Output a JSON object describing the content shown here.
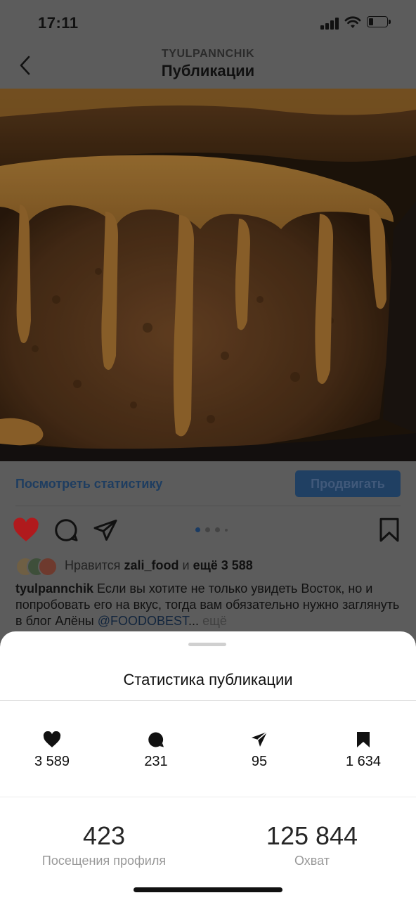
{
  "status_bar": {
    "time": "17:11",
    "battery_percent": 20
  },
  "header": {
    "username": "TYULPANNCHIK",
    "title": "Публикации"
  },
  "post": {
    "view_stats_label": "Посмотреть статистику",
    "promote_label": "Продвигать",
    "carousel": {
      "count": 4,
      "active_index": 0
    },
    "likes": {
      "prefix": "Нравится",
      "user": "zali_food",
      "connector": "и",
      "others": "ещё 3 588"
    },
    "caption": {
      "author": "tyulpannchik",
      "text": " Если вы хотите не только увидеть Восток, но и попробовать его на вкус, тогда вам обязательно нужно заглянуть в блог Алёны ",
      "mention": "@FOODOBEST",
      "ellipsis": "...",
      "more": " ещё"
    }
  },
  "stats_sheet": {
    "title": "Статистика публикации",
    "metrics": [
      {
        "icon": "heart-icon",
        "value": "3 589"
      },
      {
        "icon": "comment-icon",
        "value": "231"
      },
      {
        "icon": "send-icon",
        "value": "95"
      },
      {
        "icon": "bookmark-icon",
        "value": "1 634"
      }
    ],
    "profile_visits": {
      "value": "423",
      "label": "Посещения профиля"
    },
    "reach": {
      "value": "125 844",
      "label": "Охват"
    }
  },
  "colors": {
    "overlay_gray": "#5c5c5c",
    "like_red": "#b01a1d",
    "link_blue_dimmed": "#1e3d60",
    "promote_button_dimmed": "#204063",
    "caramel": "#9a6a2e"
  }
}
